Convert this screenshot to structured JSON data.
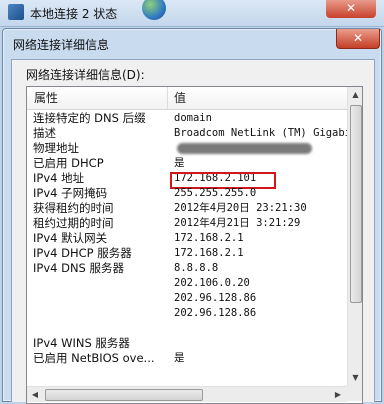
{
  "background_window": {
    "title": "本地连接 2 状态",
    "close_glyph": "✕"
  },
  "dialog": {
    "title": "网络连接详细信息",
    "close_glyph": "✕",
    "section_label": "网络连接详细信息(D):",
    "columns": {
      "property": "属性",
      "value": "值"
    },
    "rows": [
      {
        "property": "连接特定的 DNS 后缀",
        "value": "domain"
      },
      {
        "property": "描述",
        "value": "Broadcom NetLink (TM) Gigabit"
      },
      {
        "property": "物理地址",
        "value": "",
        "redacted": true
      },
      {
        "property": "已启用 DHCP",
        "value": "是"
      },
      {
        "property": "IPv4 地址",
        "value": "172.168.2.101",
        "highlighted": true
      },
      {
        "property": "IPv4 子网掩码",
        "value": "255.255.255.0"
      },
      {
        "property": "获得租约的时间",
        "value": "2012年4月20日 23:21:30"
      },
      {
        "property": "租约过期的时间",
        "value": "2012年4月21日 3:21:29"
      },
      {
        "property": "IPv4 默认网关",
        "value": "172.168.2.1"
      },
      {
        "property": "IPv4 DHCP 服务器",
        "value": "172.168.2.1"
      },
      {
        "property": "IPv4 DNS 服务器",
        "value": "8.8.8.8"
      },
      {
        "property": "",
        "value": "202.106.0.20"
      },
      {
        "property": "",
        "value": "202.96.128.86"
      },
      {
        "property": "",
        "value": "202.96.128.86"
      },
      {
        "property": "",
        "value": ""
      },
      {
        "property": "IPv4 WINS 服务器",
        "value": ""
      },
      {
        "property": "已启用 NetBIOS ove...",
        "value": "是"
      }
    ],
    "highlight_color": "#d2161b"
  }
}
